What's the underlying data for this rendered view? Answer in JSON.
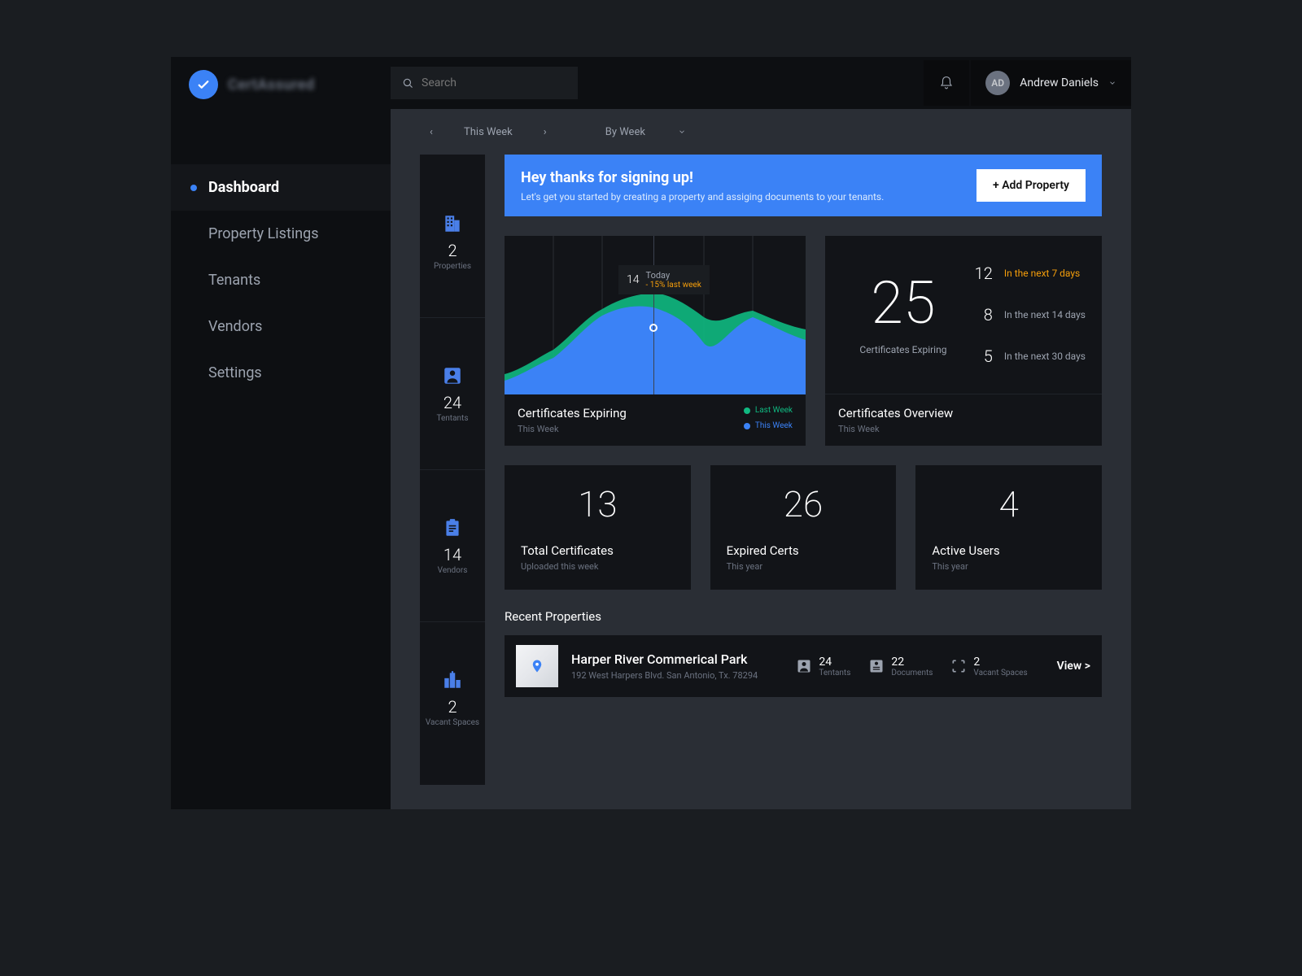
{
  "brand": {
    "name": "CertAssured"
  },
  "search": {
    "placeholder": "Search"
  },
  "user": {
    "initials": "AD",
    "name": "Andrew Daniels"
  },
  "nav": [
    {
      "label": "Dashboard",
      "active": true
    },
    {
      "label": "Property Listings"
    },
    {
      "label": "Tenants"
    },
    {
      "label": "Vendors"
    },
    {
      "label": "Settings"
    }
  ],
  "filter": {
    "period": "This Week",
    "mode": "By Week"
  },
  "quickstats": [
    {
      "icon": "building",
      "value": "2",
      "label": "Properties"
    },
    {
      "icon": "person",
      "value": "24",
      "label": "Tentants"
    },
    {
      "icon": "clipboard",
      "value": "14",
      "label": "Vendors"
    },
    {
      "icon": "city",
      "value": "2",
      "label": "Vacant Spaces"
    }
  ],
  "banner": {
    "title": "Hey thanks for signing up!",
    "subtitle": "Let's get you started by creating a property and assiging documents to your tenants.",
    "cta": "+ Add Property"
  },
  "chart": {
    "title": "Certificates Expiring",
    "subtitle": "This Week",
    "legend": [
      {
        "color": "#10b981",
        "label": "Last Week"
      },
      {
        "color": "#3b82f6",
        "label": "This Week"
      }
    ],
    "tooltip": {
      "value": "14",
      "label": "Today",
      "delta": "- 15% last week"
    }
  },
  "overview": {
    "big": {
      "value": "25",
      "label": "Certificates Expiring"
    },
    "breakdown": [
      {
        "value": "12",
        "label": "In the next 7 days",
        "highlight": true
      },
      {
        "value": "8",
        "label": "In the next 14 days"
      },
      {
        "value": "5",
        "label": "In the next 30 days"
      }
    ],
    "title": "Certificates Overview",
    "subtitle": "This Week"
  },
  "stats": [
    {
      "value": "13",
      "title": "Total Certificates",
      "subtitle": "Uploaded this week"
    },
    {
      "value": "26",
      "title": "Expired Certs",
      "subtitle": "This year"
    },
    {
      "value": "4",
      "title": "Active Users",
      "subtitle": "This year"
    }
  ],
  "recent": {
    "title": "Recent Properties",
    "items": [
      {
        "name": "Harper River Commerical Park",
        "address": "192 West Harpers Blvd. San Antonio, Tx. 78294",
        "stats": [
          {
            "icon": "person",
            "value": "24",
            "label": "Tentants"
          },
          {
            "icon": "document",
            "value": "22",
            "label": "Documents"
          },
          {
            "icon": "vacancy",
            "value": "2",
            "label": "Vacant Spaces"
          }
        ],
        "cta": "View >"
      }
    ]
  },
  "chart_data": {
    "type": "area",
    "title": "Certificates Expiring",
    "xlabel": "",
    "ylabel": "",
    "x": [
      0,
      1,
      2,
      3,
      4,
      5,
      6,
      7,
      8,
      9
    ],
    "series": [
      {
        "name": "Last Week",
        "color": "#10b981",
        "values": [
          4,
          6,
          10,
          13,
          16,
          17,
          15,
          12,
          14,
          12
        ]
      },
      {
        "name": "This Week",
        "color": "#3b82f6",
        "values": [
          3,
          5,
          9,
          12,
          15,
          14,
          13,
          8,
          13,
          11
        ]
      }
    ],
    "highlight": {
      "x": 4.5,
      "value": 14,
      "delta_pct": -15
    }
  }
}
